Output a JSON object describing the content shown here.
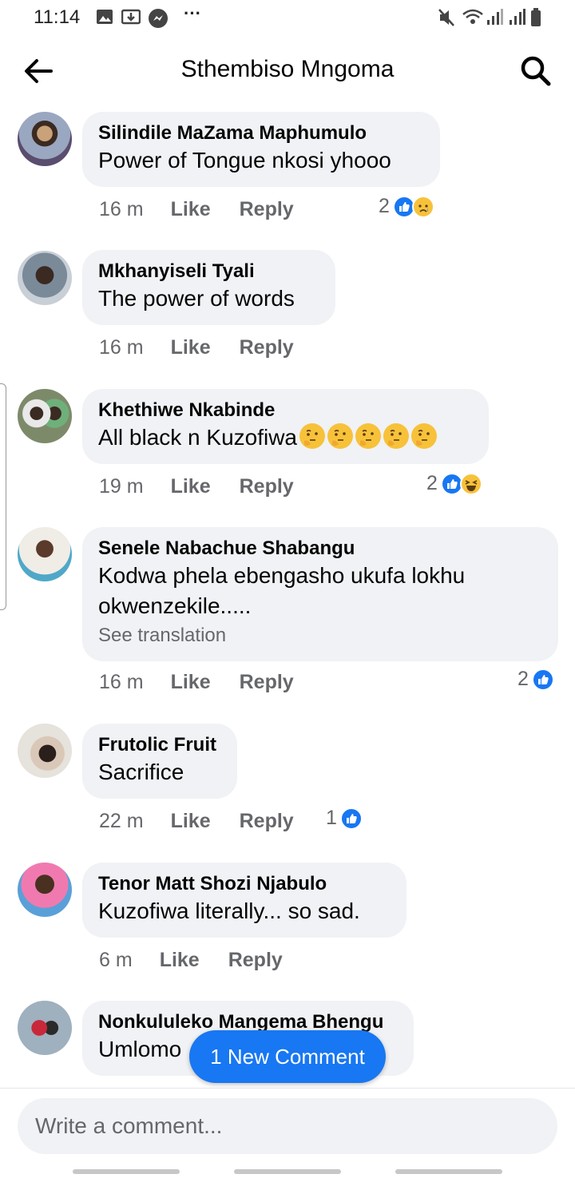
{
  "status_bar": {
    "time": "11:14",
    "more": "···"
  },
  "header": {
    "title": "Sthembiso Mngoma"
  },
  "comments": [
    {
      "author": "Silindile MaZama Maphumulo",
      "text": "Power of Tongue nkosi yhooo",
      "time": "16 m",
      "like": "Like",
      "reply": "Reply",
      "reaction_count": "2",
      "reactions": [
        "like-icon",
        "sad-icon"
      ]
    },
    {
      "author": "Mkhanyiseli Tyali",
      "text": "The power of words",
      "time": "16 m",
      "like": "Like",
      "reply": "Reply"
    },
    {
      "author": "Khethiwe Nkabinde",
      "text": "All black n Kuzofiwa",
      "emoji_count": 5,
      "time": "19 m",
      "like": "Like",
      "reply": "Reply",
      "reaction_count": "2",
      "reactions": [
        "like-icon",
        "haha-icon"
      ]
    },
    {
      "author": "Senele Nabachue Shabangu",
      "text": "Kodwa phela ebengasho ukufa lokhu",
      "text2": "okwenzekile.....",
      "see_translation": "See translation",
      "time": "16 m",
      "like": "Like",
      "reply": "Reply",
      "reaction_count": "2",
      "reactions": [
        "like-icon"
      ]
    },
    {
      "author": "Frutolic Fruit",
      "text": "Sacrifice",
      "time": "22 m",
      "like": "Like",
      "reply": "Reply",
      "reaction_count": "1",
      "reactions": [
        "like-icon"
      ]
    },
    {
      "author": "Tenor Matt Shozi Njabulo",
      "text": "Kuzofiwa literally... so sad.",
      "time": "6 m",
      "like": "Like",
      "reply": "Reply"
    },
    {
      "author": "Nonkululeko Mangema Bhengu",
      "text": "Umlomo"
    }
  ],
  "new_comment_pill": "1 New Comment",
  "composer": {
    "placeholder": "Write a comment..."
  },
  "colors": {
    "accent": "#1877f2",
    "bubble": "#f0f2f5",
    "meta": "#65676b"
  }
}
